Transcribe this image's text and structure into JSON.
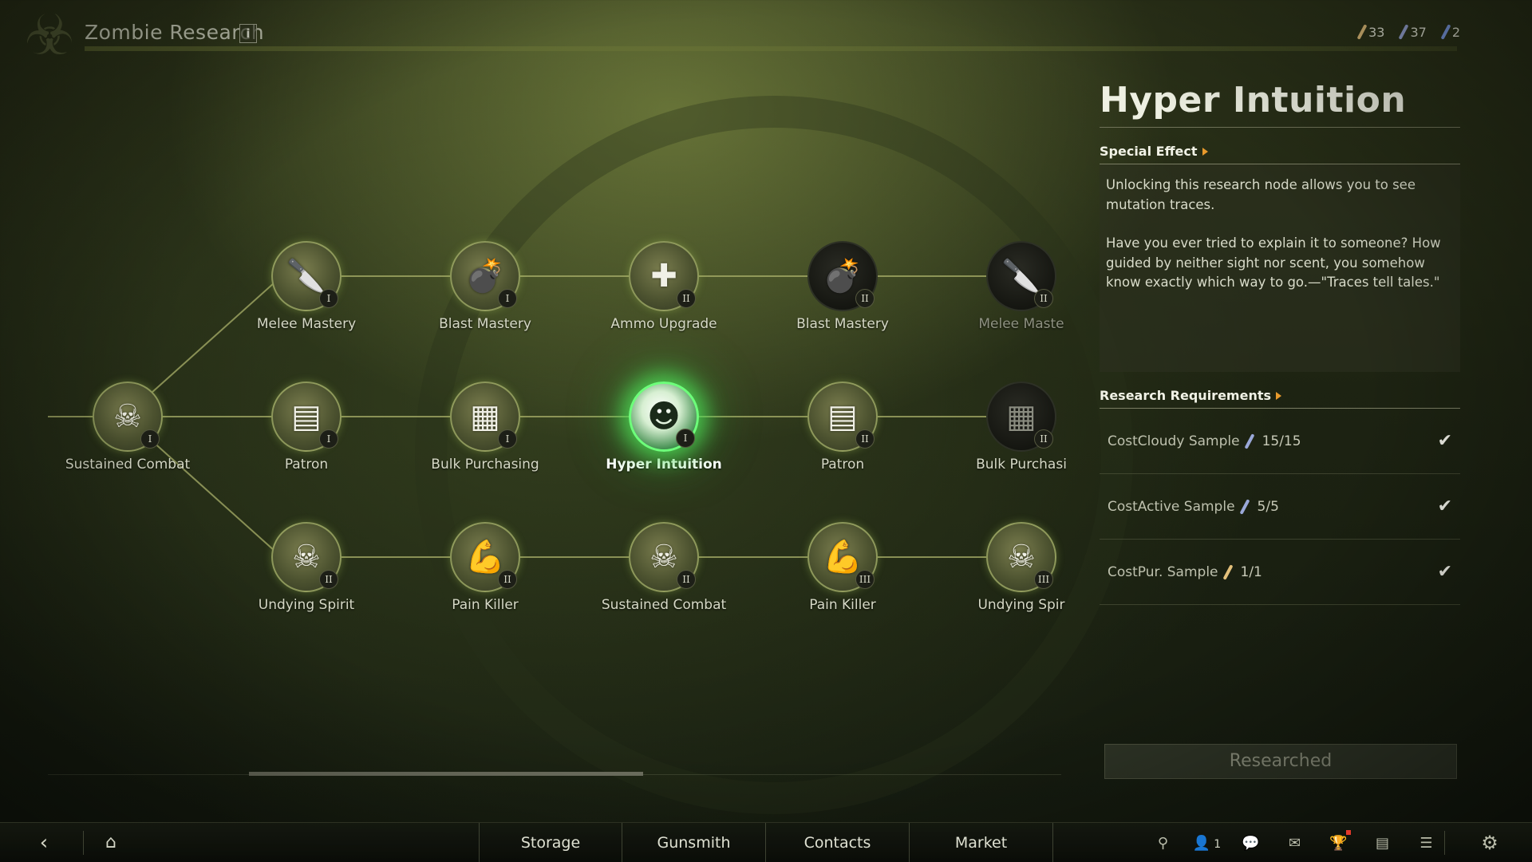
{
  "header": {
    "title": "Zombie Research",
    "info_label": "i",
    "logo_icon": "biohazard-icon"
  },
  "resources": [
    {
      "icon": "cloudy-sample-vial-icon",
      "count": "33",
      "color": "#e3c07a"
    },
    {
      "icon": "active-sample-vial-icon",
      "count": "37",
      "color": "#9aa8d8"
    },
    {
      "icon": "pure-sample-vial-icon",
      "count": "2",
      "color": "#7fa0e8"
    }
  ],
  "tree": {
    "nodes": [
      {
        "id": "n0",
        "label": "Sustained Combat",
        "tier": "I",
        "icon": "skull-plus-icon",
        "state": "unlocked"
      },
      {
        "id": "n1",
        "label": "Melee Mastery",
        "tier": "I",
        "icon": "knife-upgrade-icon",
        "state": "unlocked"
      },
      {
        "id": "n2",
        "label": "Blast Mastery",
        "tier": "I",
        "icon": "grenade-upgrade-icon",
        "state": "unlocked"
      },
      {
        "id": "n3",
        "label": "Ammo Upgrade",
        "tier": "II",
        "icon": "rifle-upgrade-icon",
        "state": "unlocked"
      },
      {
        "id": "n4",
        "label": "Blast Mastery",
        "tier": "II",
        "icon": "grenade-upgrade-icon",
        "state": "locked"
      },
      {
        "id": "n5",
        "label": "Melee Maste",
        "tier": "II",
        "icon": "knife-upgrade-icon",
        "state": "locked"
      },
      {
        "id": "n6",
        "label": "Patron",
        "tier": "I",
        "icon": "discount-crates-icon",
        "state": "unlocked"
      },
      {
        "id": "n7",
        "label": "Bulk Purchasing",
        "tier": "I",
        "icon": "bulk-crates-icon",
        "state": "unlocked"
      },
      {
        "id": "n8",
        "label": "Hyper Intuition",
        "tier": "I",
        "icon": "soldier-pointing-icon",
        "state": "selected"
      },
      {
        "id": "n9",
        "label": "Patron",
        "tier": "II",
        "icon": "discount-crates-icon",
        "state": "unlocked"
      },
      {
        "id": "n10",
        "label": "Bulk Purchasi",
        "tier": "II",
        "icon": "bulk-crates-icon",
        "state": "locked"
      },
      {
        "id": "n11",
        "label": "Undying Spirit",
        "tier": "II",
        "icon": "skull-plus-icon",
        "state": "unlocked"
      },
      {
        "id": "n12",
        "label": "Pain Killer",
        "tier": "II",
        "icon": "flexed-arm-icon",
        "state": "unlocked"
      },
      {
        "id": "n13",
        "label": "Sustained Combat",
        "tier": "II",
        "icon": "skull-plus-icon",
        "state": "unlocked"
      },
      {
        "id": "n14",
        "label": "Pain Killer",
        "tier": "III",
        "icon": "flexed-arm-icon",
        "state": "unlocked"
      },
      {
        "id": "n15",
        "label": "Undying Spir",
        "tier": "III",
        "icon": "skull-plus-icon",
        "state": "unlocked"
      }
    ]
  },
  "detail": {
    "title": "Hyper Intuition",
    "special_effect_heading": "Special Effect",
    "effect_text_1": "Unlocking this research node allows you to see mutation traces.",
    "effect_text_2": "Have you ever tried to explain it to someone? How guided by neither sight nor scent, you somehow know exactly which way to go.—\"Traces tell tales.\"",
    "requirements_heading": "Research Requirements",
    "requirements": [
      {
        "name": "CostCloudy Sample",
        "count": "15/15",
        "vial_color": "#9aa8d8",
        "done": "✔"
      },
      {
        "name": "CostActive Sample",
        "count": "5/5",
        "vial_color": "#9aa8d8",
        "done": "✔"
      },
      {
        "name": "CostPur. Sample",
        "count": "1/1",
        "vial_color": "#e3c07a",
        "done": "✔"
      }
    ],
    "action_label": "Researched"
  },
  "bottom_nav": {
    "tabs": [
      "Storage",
      "Gunsmith",
      "Contacts",
      "Market"
    ],
    "friends_count": "1"
  }
}
